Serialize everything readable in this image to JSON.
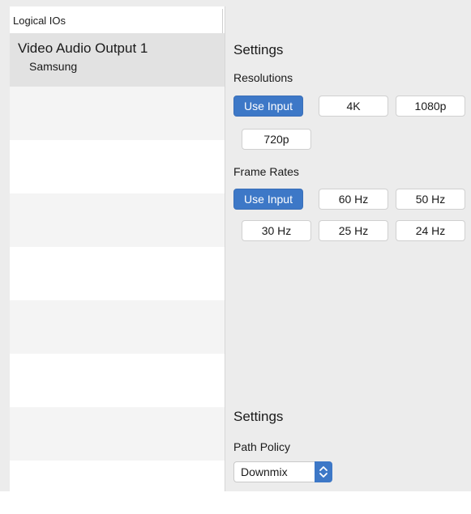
{
  "sidebar": {
    "header": "Logical IOs",
    "selected_item": {
      "title": "Video Audio Output 1",
      "subtitle": "Samsung"
    }
  },
  "settings_top": {
    "title": "Settings",
    "resolutions_label": "Resolutions",
    "resolutions": [
      "Use Input",
      "4K",
      "1080p",
      "720p"
    ],
    "resolutions_selected": "Use Input",
    "frame_rates_label": "Frame Rates",
    "frame_rates": [
      "Use Input",
      "60 Hz",
      "50 Hz",
      "30 Hz",
      "25 Hz",
      "24 Hz"
    ],
    "frame_rates_selected": "Use Input"
  },
  "settings_bottom": {
    "title": "Settings",
    "path_policy_label": "Path Policy",
    "path_policy_value": "Downmix"
  },
  "colors": {
    "accent": "#3d78c7",
    "panel": "#ececec",
    "selected_row": "#e2e2e2"
  }
}
